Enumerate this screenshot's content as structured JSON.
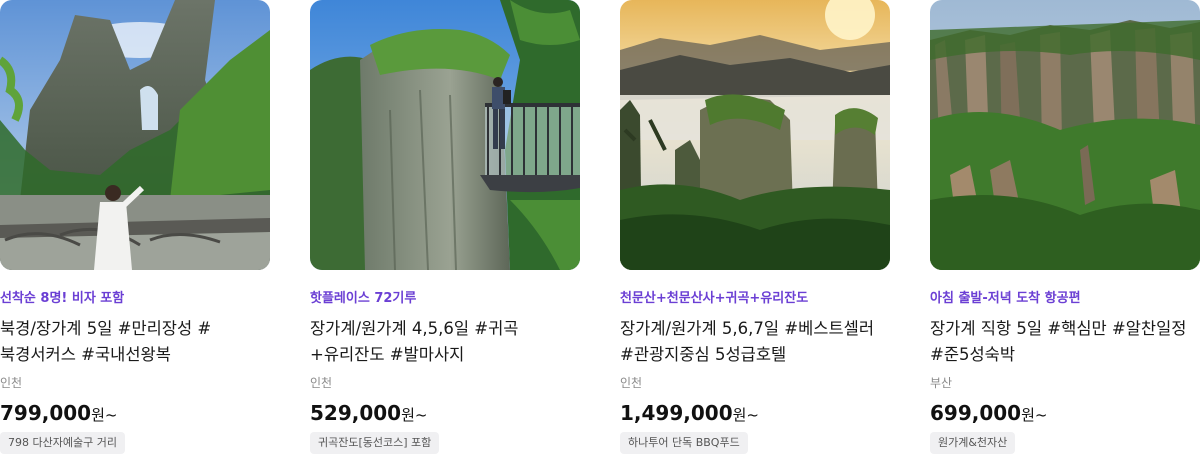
{
  "products": [
    {
      "tagline": "선착순 8명! 비자 포함",
      "title": "북경/장가계 5일 #만리장성 #북경서커스 #국내선왕복",
      "origin": "인천",
      "price": "799,000",
      "price_unit": "원~",
      "badge": "798 다산자예술구 거리",
      "image_desc": "tianmen-mountain-photo"
    },
    {
      "tagline": "핫플레이스 72기루",
      "title": "장가계/원가계 4,5,6일 #귀곡+유리잔도 #발마사지",
      "origin": "인천",
      "price": "529,000",
      "price_unit": "원~",
      "badge": "귀곡잔도[동선코스] 포함",
      "image_desc": "cliff-glass-skywalk-photo"
    },
    {
      "tagline": "천문산+천문산사+귀곡+유리잔도",
      "title": "장가계/원가계 5,6,7일 #베스트셀러 #관광지중심 5성급호텔",
      "origin": "인천",
      "price": "1,499,000",
      "price_unit": "원~",
      "badge": "하나투어 단독 BBQ푸드",
      "image_desc": "sunrise-sea-of-clouds-photo"
    },
    {
      "tagline": "아침 출발-저녁 도착 항공편",
      "title": "장가계 직항 5일 #핵심만 #알찬일정 #준5성숙박",
      "origin": "부산",
      "price": "699,000",
      "price_unit": "원~",
      "badge": "원가계&천자산",
      "image_desc": "sandstone-pillar-valley-photo"
    }
  ],
  "colors": {
    "tagline": "#6b3fd4",
    "badge_bg": "#f0f0f2",
    "origin": "#8a8a8a"
  }
}
